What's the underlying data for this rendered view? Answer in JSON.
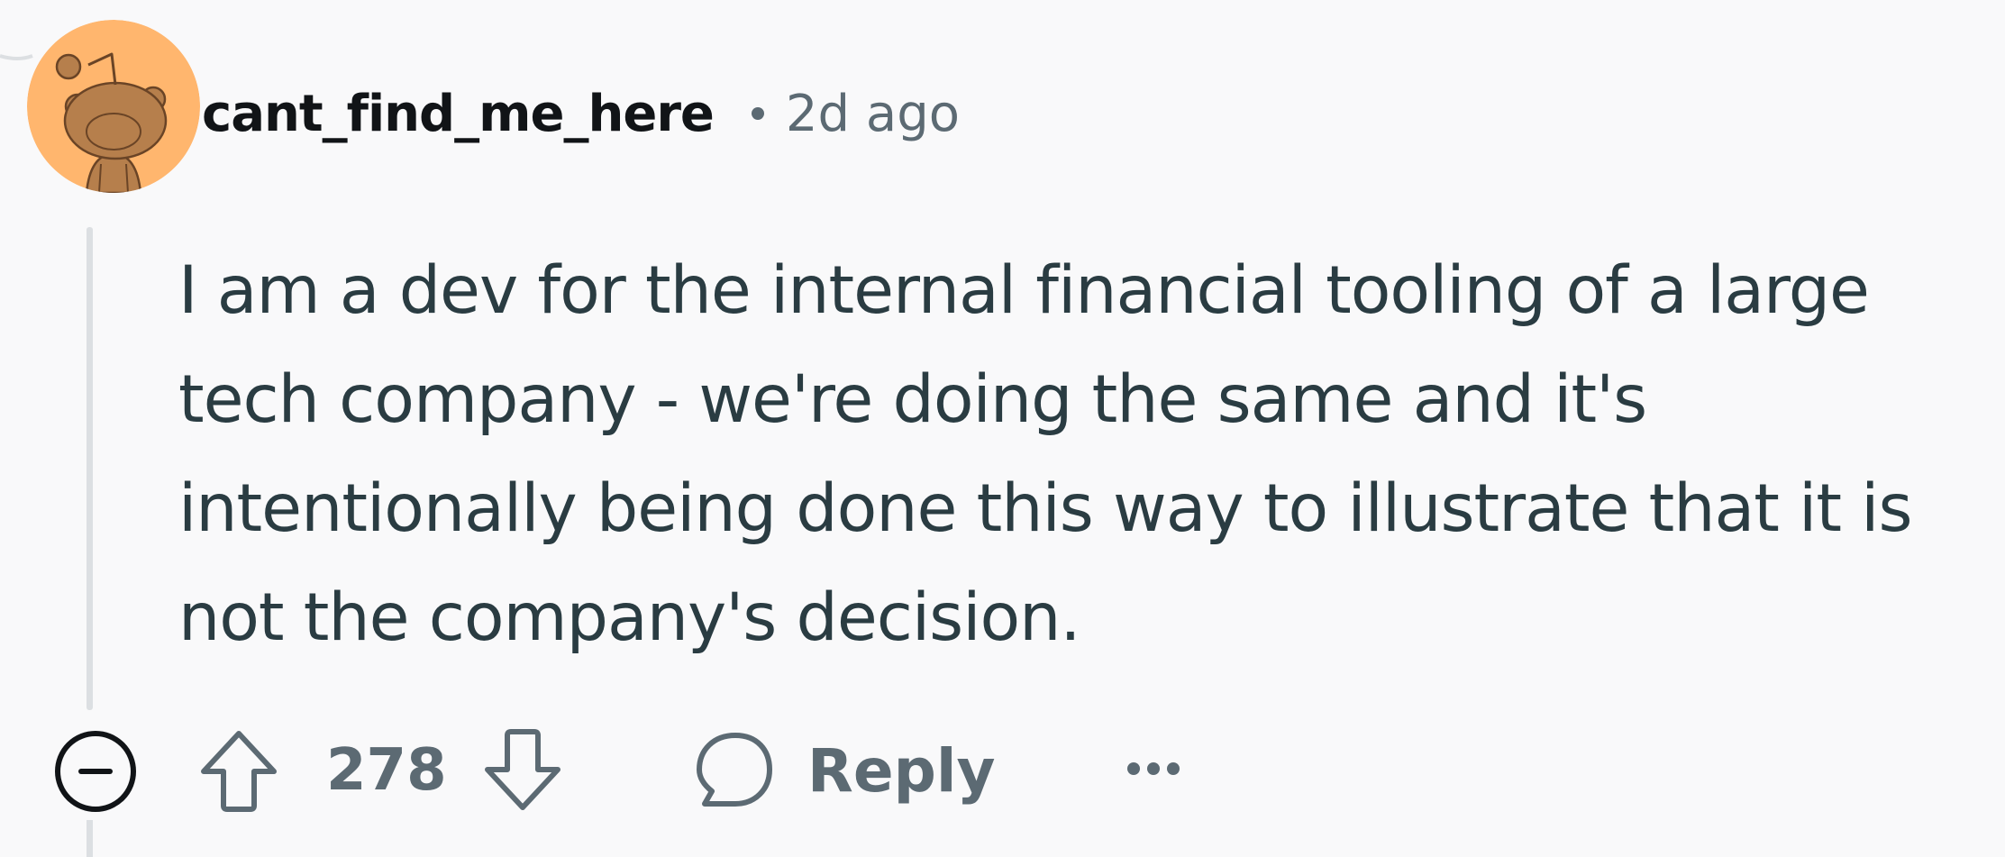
{
  "comment": {
    "username": "cant_find_me_here",
    "separator": "•",
    "timestamp": "2d ago",
    "body": "I am a dev for the internal financial tooling of a large tech company - we're doing the same and it's intentionally being done this way to illustrate that it is not the company's decision.",
    "avatar_icon": "snoo-avatar-icon",
    "avatar_bg_color": "#ffb66e"
  },
  "actions": {
    "collapse_icon": "minus-circle-icon",
    "upvote_icon": "arrow-up-icon",
    "vote_count": "278",
    "downvote_icon": "arrow-down-icon",
    "reply_icon": "speech-bubble-icon",
    "reply_label": "Reply",
    "more_icon": "ellipsis-icon"
  },
  "colors": {
    "text_primary": "#111417",
    "text_body": "#2a3c42",
    "text_secondary": "#5c6a73",
    "background": "#f9f9fa"
  }
}
